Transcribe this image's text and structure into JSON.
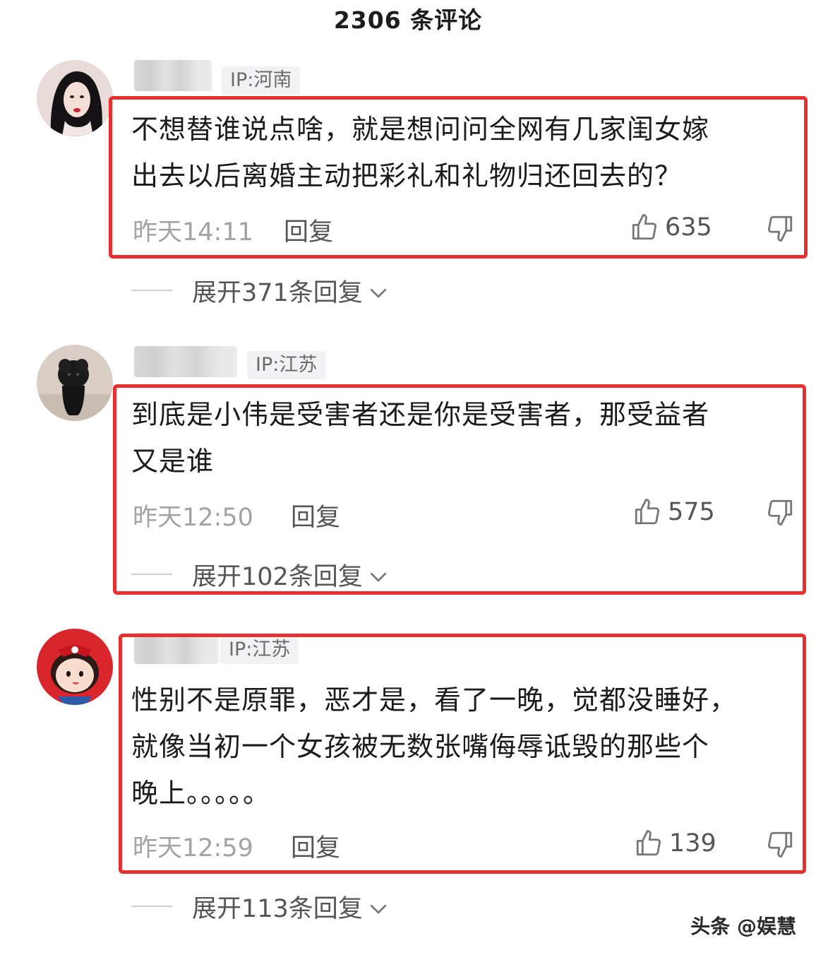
{
  "header": {
    "title": "2306 条评论"
  },
  "comments": [
    {
      "ip": "IP:河南",
      "text_lines": [
        "不想替谁说点啥，就是想问问全网有几家闺女嫁",
        "出去以后离婚主动把彩礼和礼物归还回去的？"
      ],
      "time": "昨天14:11",
      "reply_label": "回复",
      "likes": "635",
      "expand_label": "展开371条回复"
    },
    {
      "ip": "IP:江苏",
      "text_lines": [
        "到底是小伟是受害者还是你是受害者，那受益者",
        "又是谁"
      ],
      "time": "昨天12:50",
      "reply_label": "回复",
      "likes": "575",
      "expand_label": "展开102条回复"
    },
    {
      "ip": "IP:江苏",
      "text_lines": [
        "性别不是原罪，恶才是，看了一晚，觉都没睡好，",
        "就像当初一个女孩被无数张嘴侮辱诋毁的那些个",
        "晚上。。。。。"
      ],
      "time": "昨天12:59",
      "reply_label": "回复",
      "likes": "139",
      "expand_label": "展开113条回复"
    }
  ],
  "watermark": "头条 @娱慧",
  "colors": {
    "highlight": "#e8302f",
    "meta_gray": "#a3a3a3",
    "badge_bg": "#f2f2f4"
  },
  "icons": [
    "thumb-up-icon",
    "thumb-down-icon",
    "chevron-down-icon"
  ]
}
